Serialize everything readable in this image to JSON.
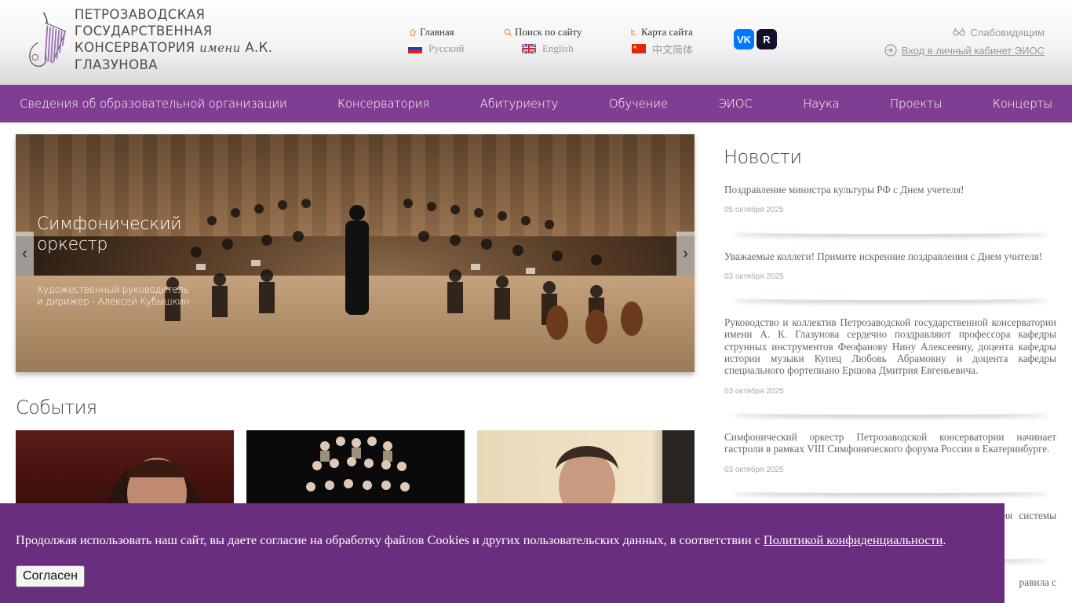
{
  "header": {
    "logo_line1": "ПЕТРОЗАВОДСКАЯ ГОСУДАРСТВЕННАЯ",
    "logo_line2_pre": "КОНСЕРВАТОРИЯ ",
    "logo_line2_italic": "имени",
    "logo_line2_post": " А.К. ГЛАЗУНОВА",
    "links": [
      {
        "label": "Главная",
        "icon": "home-icon"
      },
      {
        "label": "Поиск по сайту",
        "icon": "search-icon"
      },
      {
        "label": "Карта сайта",
        "icon": "sitemap-icon"
      }
    ],
    "languages": [
      {
        "label": "Русский",
        "flag": "flag-ru"
      },
      {
        "label": "English",
        "flag": "flag-uk"
      },
      {
        "label": "中文简体",
        "flag": "flag-cn"
      }
    ],
    "social": [
      {
        "label": "VK",
        "icon": "vk-icon",
        "color": "#0077ff"
      },
      {
        "label": "R",
        "icon": "rutube-icon",
        "color": "#12102a"
      }
    ],
    "low_vision": "Слабовидящим",
    "eios_login": "Вход в личный кабинет ЭИОС"
  },
  "nav": {
    "items": [
      "Сведения об образовательной организации",
      "Консерватория",
      "Абитуриенту",
      "Обучение",
      "ЭИОС",
      "Наука",
      "Проекты",
      "Концерты"
    ],
    "color": "#7f3e91"
  },
  "slider": {
    "title": "Симфонический оркестр",
    "subtitle": "Художественный руководитель и дирижёр - Алексей Кубышкин"
  },
  "events": {
    "title": "События"
  },
  "news": {
    "title": "Новости",
    "items": [
      {
        "text": "Поздравление министра культуры РФ с Днем учетеля!",
        "date": "05 октября 2025"
      },
      {
        "text": "Уважаемые коллеги! Примите искренние поздравления с Днем учителя!",
        "date": "03 октября 2025"
      },
      {
        "text": "Руководство и коллектив Петрозаводской государственной консерватории имени А. К. Глазунова сердечно поздравляют профессора кафедры струнных инструментов Феофанову Нину Алексеевну, доцента кафедры истории музыки Купец Любовь Абрамовну и доцента кафедры специального фортепиано Ершова Дмитрия Евгеньевича.",
        "date": "03 октября 2025"
      },
      {
        "text": "Симфонический оркестр Петрозаводской консерватории начинает гастроли в рамках VIII Симфонического форума России в Екатеринбурге.",
        "date": "03 октября 2025"
      },
      {
        "text": "2 октября 2025 года исполняется 85 лет со дня основания системы среднего профессионального образования в России",
        "date": ""
      }
    ],
    "partial_text": "равила с"
  },
  "cookie": {
    "text": "Продолжая использовать наш сайт, вы даете согласие на обработку файлов Cookies и других пользовательских данных, в соответствии с ",
    "link": "Политикой конфиденциальности",
    "end": ".",
    "button": "Согласен",
    "color": "#6a2e7e"
  }
}
